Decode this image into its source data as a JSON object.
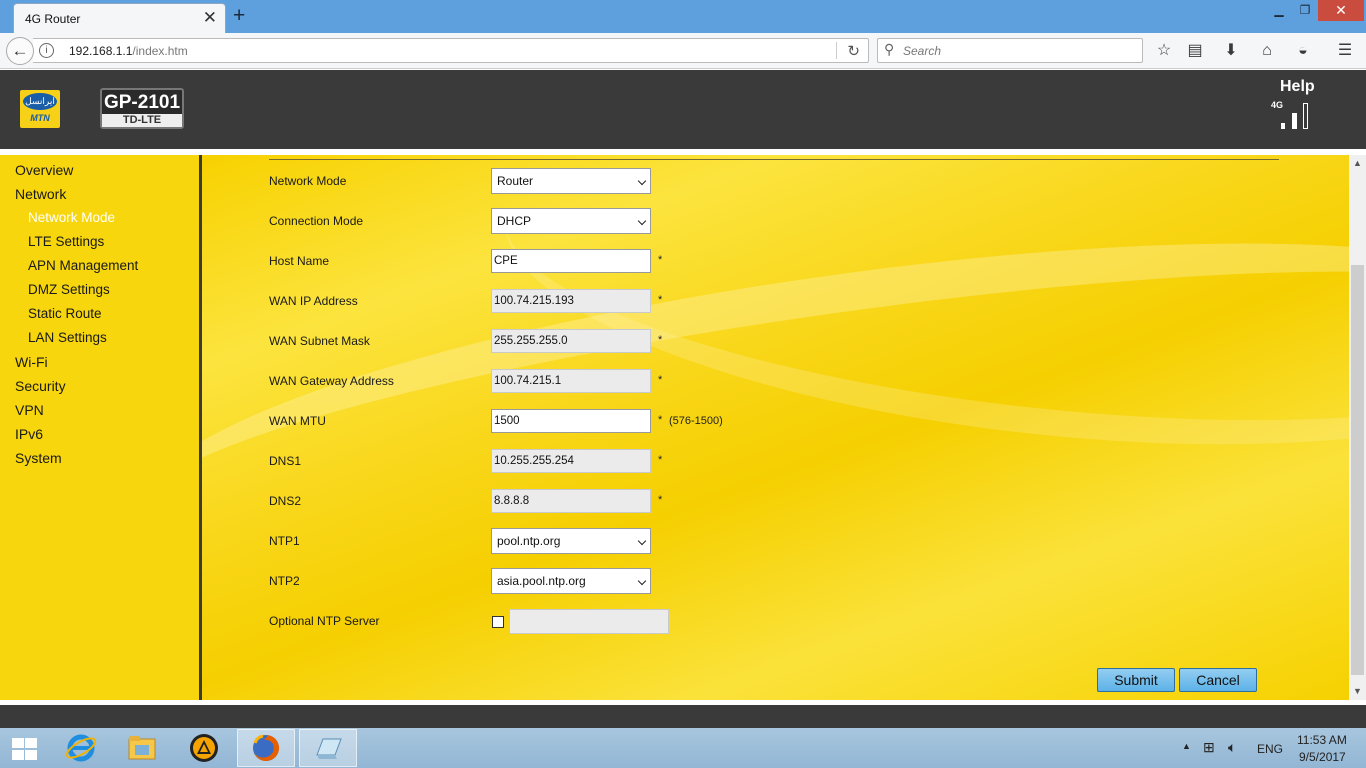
{
  "browser": {
    "tab_title": "4G Router",
    "url_host": "192.168.1.1",
    "url_path": "/index.htm",
    "search_placeholder": "Search"
  },
  "router": {
    "brand": "MTN",
    "brand_persian": "ایرانسل",
    "model": "GP-2101",
    "model_sub": "TD-LTE",
    "help": "Help",
    "signal_label": "4G"
  },
  "sidebar": {
    "items": [
      {
        "label": "Overview",
        "level": 1,
        "active": false
      },
      {
        "label": "Network",
        "level": 1,
        "active": false
      },
      {
        "label": "Network Mode",
        "level": 2,
        "active": true
      },
      {
        "label": "LTE Settings",
        "level": 2,
        "active": false
      },
      {
        "label": "APN Management",
        "level": 2,
        "active": false
      },
      {
        "label": "DMZ Settings",
        "level": 2,
        "active": false
      },
      {
        "label": "Static Route",
        "level": 2,
        "active": false
      },
      {
        "label": "LAN Settings",
        "level": 2,
        "active": false
      },
      {
        "label": "Wi-Fi",
        "level": 1,
        "active": false
      },
      {
        "label": "Security",
        "level": 1,
        "active": false
      },
      {
        "label": "VPN",
        "level": 1,
        "active": false
      },
      {
        "label": "IPv6",
        "level": 1,
        "active": false
      },
      {
        "label": "System",
        "level": 1,
        "active": false
      }
    ]
  },
  "form": {
    "network_mode": {
      "label": "Network Mode",
      "value": "Router"
    },
    "connection_mode": {
      "label": "Connection Mode",
      "value": "DHCP"
    },
    "host_name": {
      "label": "Host Name",
      "value": "CPE",
      "required": "*"
    },
    "wan_ip": {
      "label": "WAN IP Address",
      "value": "100.74.215.193",
      "required": "*"
    },
    "wan_subnet": {
      "label": "WAN Subnet Mask",
      "value": "255.255.255.0",
      "required": "*"
    },
    "wan_gateway": {
      "label": "WAN Gateway Address",
      "value": "100.74.215.1",
      "required": "*"
    },
    "wan_mtu": {
      "label": "WAN MTU",
      "value": "1500",
      "required": "*",
      "hint": "(576-1500)"
    },
    "dns1": {
      "label": "DNS1",
      "value": "10.255.255.254",
      "required": "*"
    },
    "dns2": {
      "label": "DNS2",
      "value": "8.8.8.8",
      "required": "*"
    },
    "ntp1": {
      "label": "NTP1",
      "value": "pool.ntp.org"
    },
    "ntp2": {
      "label": "NTP2",
      "value": "asia.pool.ntp.org"
    },
    "optional_ntp": {
      "label": "Optional NTP Server",
      "checked": false,
      "value": ""
    },
    "submit_label": "Submit",
    "cancel_label": "Cancel"
  },
  "taskbar": {
    "language": "ENG",
    "time": "11:53 AM",
    "date": "9/5/2017"
  },
  "colors": {
    "accent_yellow": "#f7d60d",
    "header_dark": "#3a3a3a",
    "button_blue": "#5db2e8",
    "active_nav": "#ffffff"
  }
}
